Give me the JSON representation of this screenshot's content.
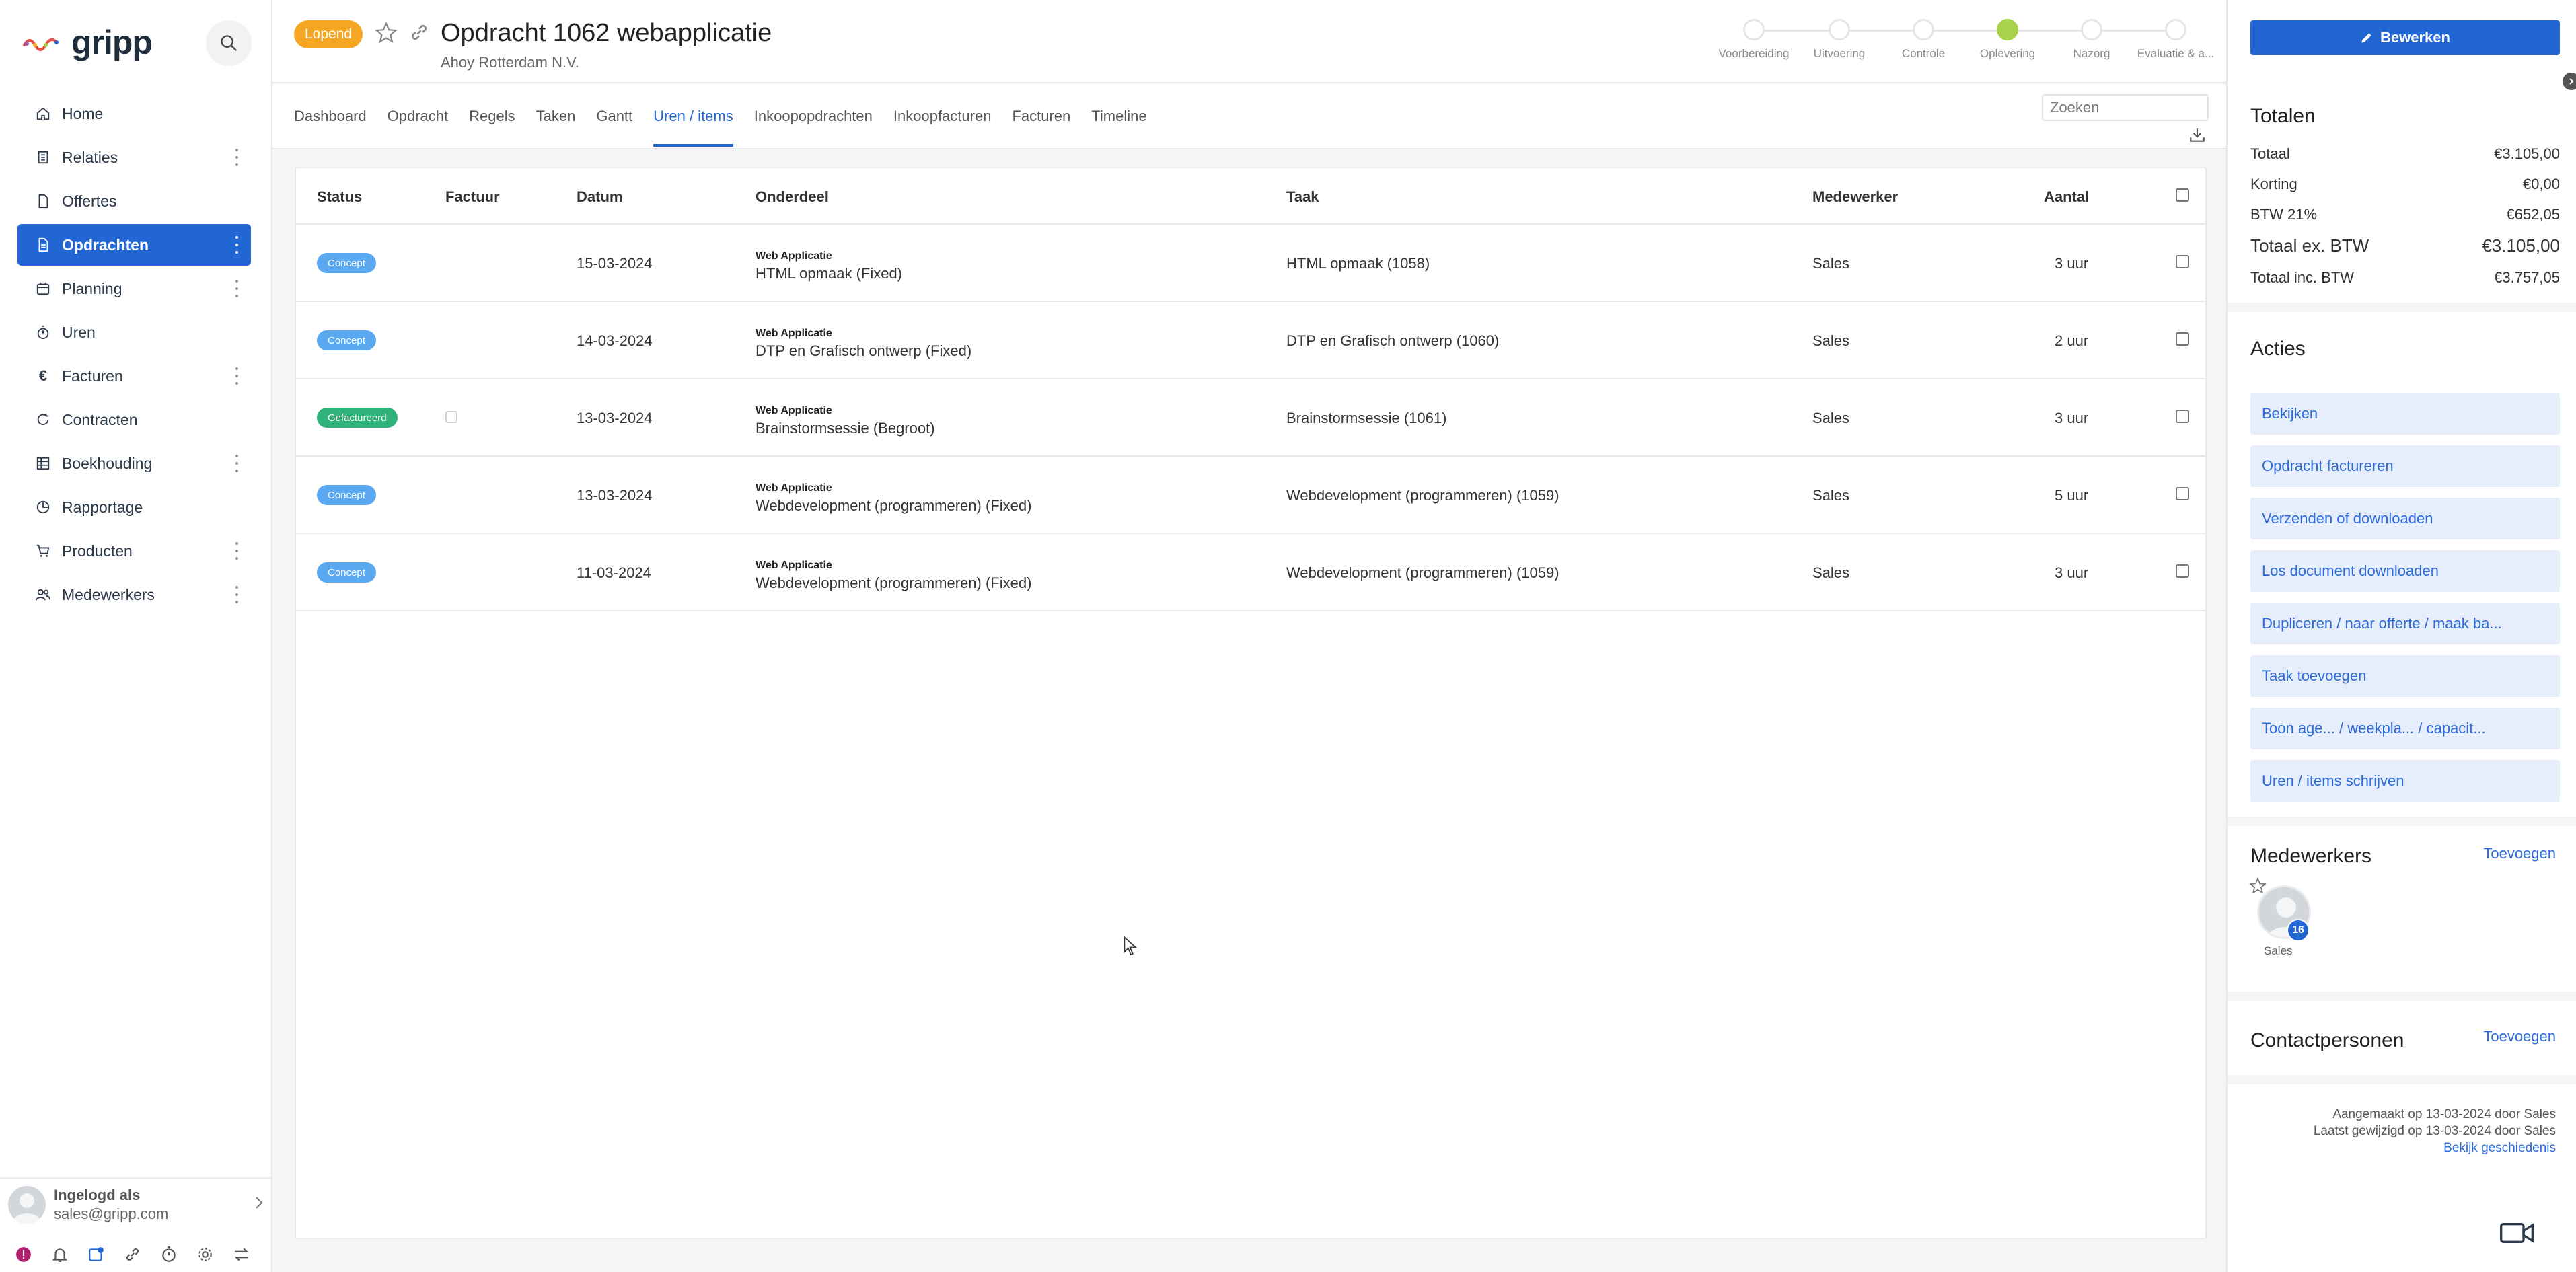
{
  "app": {
    "logo_text": "gripp"
  },
  "sidebar": {
    "items": [
      {
        "label": "Home",
        "icon": "home-icon",
        "has_menu": false
      },
      {
        "label": "Relaties",
        "icon": "building-icon",
        "has_menu": true
      },
      {
        "label": "Offertes",
        "icon": "document-icon",
        "has_menu": false
      },
      {
        "label": "Opdrachten",
        "icon": "document-icon",
        "has_menu": true,
        "active": true
      },
      {
        "label": "Planning",
        "icon": "calendar-icon",
        "has_menu": true
      },
      {
        "label": "Uren",
        "icon": "stopwatch-icon",
        "has_menu": false
      },
      {
        "label": "Facturen",
        "icon": "euro-icon",
        "has_menu": true
      },
      {
        "label": "Contracten",
        "icon": "refresh-icon",
        "has_menu": false
      },
      {
        "label": "Boekhouding",
        "icon": "grid-icon",
        "has_menu": true
      },
      {
        "label": "Rapportage",
        "icon": "pie-chart-icon",
        "has_menu": false
      },
      {
        "label": "Producten",
        "icon": "cart-icon",
        "has_menu": true
      },
      {
        "label": "Medewerkers",
        "icon": "users-icon",
        "has_menu": true
      }
    ],
    "user": {
      "label": "Ingelogd als",
      "email": "sales@gripp.com"
    }
  },
  "header": {
    "status": "Lopend",
    "status_color": "#f5a623",
    "title": "Opdracht 1062 webapplicatie",
    "subtitle": "Ahoy Rotterdam N.V.",
    "phases": [
      {
        "label": "Voorbereiding",
        "current": false
      },
      {
        "label": "Uitvoering",
        "current": false
      },
      {
        "label": "Controle",
        "current": false
      },
      {
        "label": "Oplevering",
        "current": true
      },
      {
        "label": "Nazorg",
        "current": false
      },
      {
        "label": "Evaluatie & a...",
        "current": false
      }
    ]
  },
  "tabs": {
    "items": [
      "Dashboard",
      "Opdracht",
      "Regels",
      "Taken",
      "Gantt",
      "Uren / items",
      "Inkoopopdrachten",
      "Inkoopfacturen",
      "Facturen",
      "Timeline"
    ],
    "active_index": 5,
    "search_placeholder": "Zoeken"
  },
  "table": {
    "headers": {
      "status": "Status",
      "factuur": "Factuur",
      "datum": "Datum",
      "onderdeel": "Onderdeel",
      "taak": "Taak",
      "medewerker": "Medewerker",
      "aantal": "Aantal"
    },
    "rows": [
      {
        "status": "Concept",
        "status_type": "concept",
        "factuur": "",
        "datum": "15-03-2024",
        "onderdeel_cat": "Web Applicatie",
        "onderdeel": "HTML opmaak  (Fixed)",
        "taak": "HTML opmaak  (1058)",
        "medewerker": "Sales",
        "aantal": "3 uur"
      },
      {
        "status": "Concept",
        "status_type": "concept",
        "factuur": "",
        "datum": "14-03-2024",
        "onderdeel_cat": "Web Applicatie",
        "onderdeel": "DTP en Grafisch ontwerp  (Fixed)",
        "taak": "DTP en Grafisch ontwerp  (1060)",
        "medewerker": "Sales",
        "aantal": "2 uur"
      },
      {
        "status": "Gefactureerd",
        "status_type": "gefactureerd",
        "factuur": "checkbox",
        "datum": "13-03-2024",
        "onderdeel_cat": "Web Applicatie",
        "onderdeel": "Brainstormsessie  (Begroot)",
        "taak": "Brainstormsessie  (1061)",
        "medewerker": "Sales",
        "aantal": "3 uur"
      },
      {
        "status": "Concept",
        "status_type": "concept",
        "factuur": "",
        "datum": "13-03-2024",
        "onderdeel_cat": "Web Applicatie",
        "onderdeel": "Webdevelopment (programmeren)  (Fixed)",
        "taak": "Webdevelopment (programmeren)  (1059)",
        "medewerker": "Sales",
        "aantal": "5 uur"
      },
      {
        "status": "Concept",
        "status_type": "concept",
        "factuur": "",
        "datum": "11-03-2024",
        "onderdeel_cat": "Web Applicatie",
        "onderdeel": "Webdevelopment (programmeren)  (Fixed)",
        "taak": "Webdevelopment (programmeren)  (1059)",
        "medewerker": "Sales",
        "aantal": "3 uur"
      }
    ]
  },
  "right": {
    "edit_label": "Bewerken",
    "totals_title": "Totalen",
    "totals": [
      {
        "label": "Totaal",
        "value": "€3.105,00",
        "big": false
      },
      {
        "label": "Korting",
        "value": "€0,00",
        "big": false
      },
      {
        "label": "BTW 21%",
        "value": "€652,05",
        "big": false
      },
      {
        "label": "Totaal ex. BTW",
        "value": "€3.105,00",
        "big": true
      },
      {
        "label": "Totaal inc. BTW",
        "value": "€3.757,05",
        "big": false
      }
    ],
    "actions_title": "Acties",
    "actions": [
      "Bekijken",
      "Opdracht factureren",
      "Verzenden of downloaden",
      "Los document downloaden",
      "Dupliceren / naar offerte / maak ba...",
      "Taak toevoegen",
      "Toon age...    / weekpla...    / capacit...",
      "Uren / items schrijven"
    ],
    "employees_title": "Medewerkers",
    "employees_add": "Toevoegen",
    "employee": {
      "name": "Sales",
      "count": "16"
    },
    "contacts_title": "Contactpersonen",
    "contacts_add": "Toevoegen",
    "meta_created": "Aangemaakt op 13-03-2024 door Sales",
    "meta_modified": "Laatst gewijzigd op 13-03-2024 door Sales",
    "meta_history": "Bekijk geschiedenis"
  },
  "colors": {
    "accent": "#2266d4",
    "concept_badge": "#5aa8f0",
    "gefactureerd_badge": "#2fb37b",
    "current_phase": "#a6d34a"
  }
}
